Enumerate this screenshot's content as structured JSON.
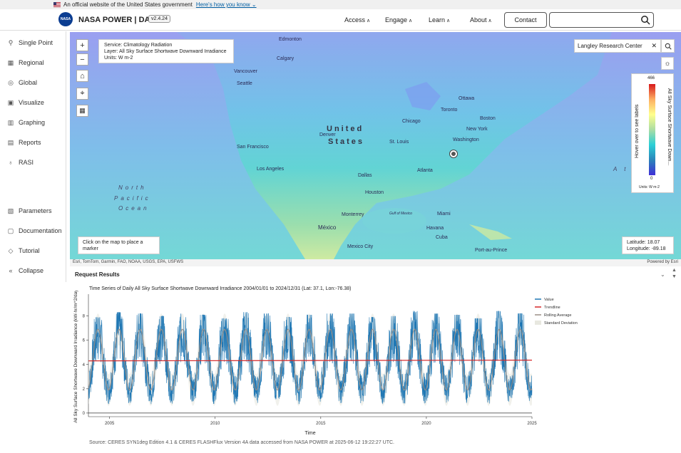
{
  "gov_banner": {
    "text": "An official website of the United States government",
    "link": "Here's how you know ⌄"
  },
  "header": {
    "logo_text": "NASA",
    "brand": "NASA POWER | DAV",
    "version": "v2.4.24",
    "nav": [
      {
        "label": "Access"
      },
      {
        "label": "Engage"
      },
      {
        "label": "Learn"
      },
      {
        "label": "About"
      }
    ],
    "contact": "Contact",
    "search_placeholder": ""
  },
  "sidebar": {
    "items": [
      {
        "label": "Single Point",
        "icon": "pin-icon",
        "glyph": "⚲"
      },
      {
        "label": "Regional",
        "icon": "region-icon",
        "glyph": "▦"
      },
      {
        "label": "Global",
        "icon": "globe-icon",
        "glyph": "◎"
      },
      {
        "label": "Visualize",
        "icon": "visualize-icon",
        "glyph": "▣"
      },
      {
        "label": "Graphing",
        "icon": "graph-icon",
        "glyph": "▥"
      },
      {
        "label": "Reports",
        "icon": "report-icon",
        "glyph": "▤"
      },
      {
        "label": "RASI",
        "icon": "bulb-icon",
        "glyph": "♁"
      },
      {
        "label": "Parameters",
        "icon": "parameters-icon",
        "glyph": "▧"
      },
      {
        "label": "Documentation",
        "icon": "doc-icon",
        "glyph": "▢"
      },
      {
        "label": "Tutorial",
        "icon": "tutorial-icon",
        "glyph": "◇"
      },
      {
        "label": "Collapse",
        "icon": "collapse-icon",
        "glyph": "«"
      }
    ]
  },
  "map": {
    "info": {
      "service": "Service: Climatology Radiation",
      "layer": "Layer: All Sky Surface Shortwave Downward Irradiance",
      "units": "Units: W m-2"
    },
    "location_value": "Langley Research Center",
    "legend": {
      "max": "466",
      "min": "0",
      "units": "Units: W m-2",
      "hover_hint": "Hover over to see labels",
      "name": "All Sky Surface Shortwave Down..."
    },
    "click_hint": "Click on the map to place a marker",
    "latitude": "Latitude: 18.07",
    "longitude": "Longitude: -89.18",
    "attribution": "Esri, TomTom, Garmin, FAO, NOAA, USGS, EPA, USFWS",
    "powered_by": "Powered by Esri",
    "labels": {
      "edmonton": "Edmonton",
      "calgary": "Calgary",
      "vancouver": "Vancouver",
      "seattle": "Seattle",
      "ottawa": "Ottawa",
      "toronto": "Toronto",
      "boston": "Boston",
      "new_york": "New York",
      "chicago": "Chicago",
      "washington": "Washington",
      "denver": "Denver",
      "st_louis": "St. Louis",
      "san_francisco": "San Francisco",
      "los_angeles": "Los Angeles",
      "dallas": "Dallas",
      "atlanta": "Atlanta",
      "houston": "Houston",
      "monterrey": "Monterrey",
      "miami": "Miami",
      "mexico": "México",
      "havana": "Havana",
      "cuba": "Cuba",
      "mexico_city": "Mexico City",
      "port_au_prince": "Port-au-Prince",
      "gulf": "Gulf of Mexico",
      "us_line1": "United",
      "us_line2": "States",
      "pacific1": "North",
      "pacific2": "Pacific",
      "pacific3": "Ocean",
      "atlantic": "A t l"
    }
  },
  "results": {
    "title": "Request Results",
    "source": "Source: CERES SYN1deg Edition 4.1 & CERES FLASHFlux Version 4A data accessed from NASA POWER at 2025-06-12 19:22:27 UTC."
  },
  "chart_data": {
    "type": "line",
    "title": "Time Series of Daily All Sky Surface Shortwave Downward Irradiance 2004/01/01 to 2024/12/31 (Lat: 37.1, Lon:-76.38)",
    "xlabel": "Time",
    "ylabel": "All Sky Surface Shortwave Downward Irradiance (kW-hr/m^2/day)",
    "xlim": [
      2004,
      2025
    ],
    "ylim": [
      -0.3,
      9.8
    ],
    "x_ticks": [
      2005,
      2010,
      2015,
      2020,
      2025
    ],
    "y_ticks": [
      0,
      2,
      4,
      6,
      8
    ],
    "legend": [
      "Value",
      "Trendline",
      "Rolling Average",
      "Standard Deviation"
    ],
    "legend_position": "right",
    "colors": {
      "value": "#1f77b4",
      "trend": "#d62728",
      "rolling": "#9a8f86",
      "std": "#e8e8e0"
    },
    "series": [
      {
        "name": "Value",
        "description_range": [
          0.2,
          8.5
        ],
        "pattern": "annual seasonal cycle, peak ~Jun, trough ~Dec"
      },
      {
        "name": "Trendline",
        "values": [
          4.3,
          4.36
        ],
        "x": [
          2004,
          2025
        ]
      },
      {
        "name": "Rolling Average",
        "pattern": "annual cycle between ~1.8 and ~6.9"
      }
    ],
    "yearly_peaks": [
      7.9,
      8.3,
      8.2,
      8.0,
      8.2,
      8.1,
      7.8,
      8.3,
      8.2,
      7.9,
      8.1,
      8.2,
      8.2,
      7.9,
      8.0,
      8.4,
      8.2,
      8.1,
      7.8,
      8.4,
      8.2
    ],
    "yearly_troughs": [
      0.6,
      0.4,
      0.5,
      0.5,
      0.4,
      0.5,
      0.5,
      0.4,
      0.5,
      0.5,
      0.4,
      0.5,
      0.4,
      0.5,
      0.4,
      0.5,
      0.4,
      0.5,
      0.5,
      0.4,
      0.5
    ]
  }
}
